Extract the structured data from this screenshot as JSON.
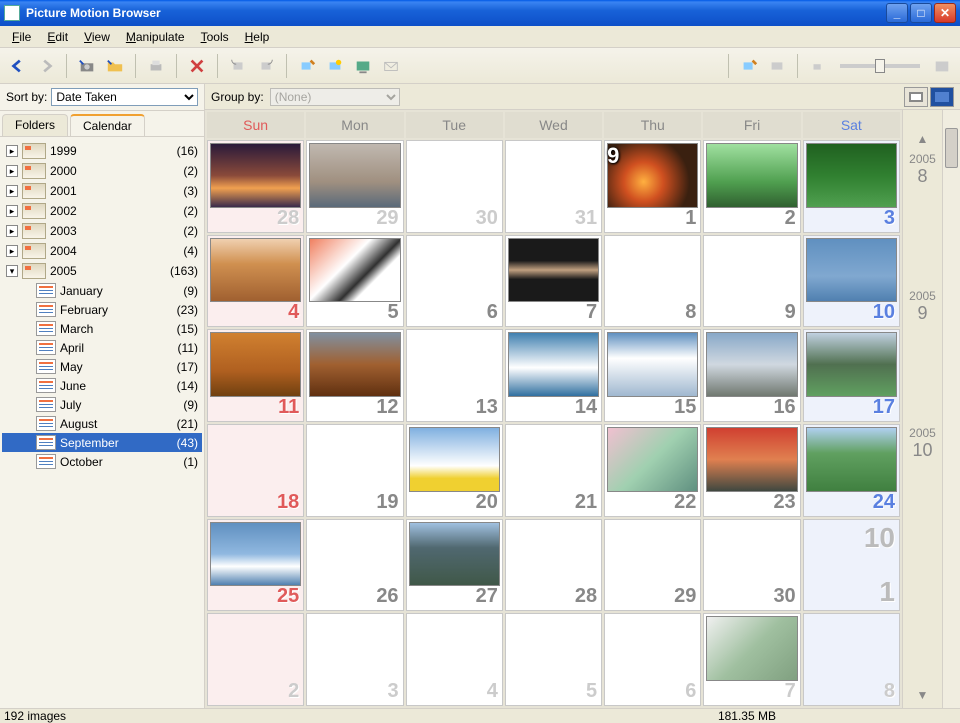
{
  "window": {
    "title": "Picture Motion Browser"
  },
  "menu": {
    "file": "File",
    "edit": "Edit",
    "view": "View",
    "manipulate": "Manipulate",
    "tools": "Tools",
    "help": "Help"
  },
  "sidebar": {
    "sort_label": "Sort by:",
    "sort_value": "Date Taken",
    "tabs": {
      "folders": "Folders",
      "calendar": "Calendar"
    },
    "years": [
      {
        "label": "1999",
        "count": "(16)"
      },
      {
        "label": "2000",
        "count": "(2)"
      },
      {
        "label": "2001",
        "count": "(3)"
      },
      {
        "label": "2002",
        "count": "(2)"
      },
      {
        "label": "2003",
        "count": "(2)"
      },
      {
        "label": "2004",
        "count": "(4)"
      },
      {
        "label": "2005",
        "count": "(163)"
      }
    ],
    "months": [
      {
        "label": "January",
        "count": "(9)"
      },
      {
        "label": "February",
        "count": "(23)"
      },
      {
        "label": "March",
        "count": "(15)"
      },
      {
        "label": "April",
        "count": "(11)"
      },
      {
        "label": "May",
        "count": "(17)"
      },
      {
        "label": "June",
        "count": "(14)"
      },
      {
        "label": "July",
        "count": "(9)"
      },
      {
        "label": "August",
        "count": "(21)"
      },
      {
        "label": "September",
        "count": "(43)"
      },
      {
        "label": "October",
        "count": "(1)"
      }
    ],
    "selected_month_index": 8
  },
  "content": {
    "group_label": "Group by:",
    "group_value": "(None)",
    "day_headers": [
      "Sun",
      "Mon",
      "Tue",
      "Wed",
      "Thu",
      "Fri",
      "Sat"
    ],
    "side_labels": [
      {
        "year": "2005",
        "month": "8"
      },
      {
        "year": "2005",
        "month": "9"
      },
      {
        "year": "2005",
        "month": "10"
      }
    ],
    "weeks": [
      [
        {
          "day": "28",
          "cls": "sun other",
          "thumb": "linear-gradient(to bottom,#2a1a3a 0%,#8a4a3a 50%,#f0a050 70%,#3a2a4a 100%)"
        },
        {
          "day": "29",
          "cls": "other",
          "thumb": "linear-gradient(to bottom,#c0b8b0 0%,#a09080 60%,#5a6a7a 100%)"
        },
        {
          "day": "30",
          "cls": "other"
        },
        {
          "day": "31",
          "cls": "other"
        },
        {
          "day": "1",
          "cls": "",
          "badge": "9",
          "thumb": "radial-gradient(circle at 40% 60%,#ffb040,#d05020 30%,#3a2010 70%)"
        },
        {
          "day": "2",
          "cls": "",
          "thumb": "linear-gradient(to bottom,#a0e0a0 0%,#50a050 60%,#306030 100%)"
        },
        {
          "day": "3",
          "cls": "sat",
          "thumb": "linear-gradient(to bottom,#206020 0%,#308030 50%,#50a050 100%)"
        }
      ],
      [
        {
          "day": "4",
          "cls": "sun",
          "thumb": "linear-gradient(to bottom,#f0d0b0 0%,#d09050 40%,#a06030 100%)"
        },
        {
          "day": "5",
          "cls": "",
          "thumb": "linear-gradient(135deg,#f08060 0%,#ffffff 40%,#303030 60%,#ffffff 70%)"
        },
        {
          "day": "6",
          "cls": ""
        },
        {
          "day": "7",
          "cls": "",
          "thumb": "linear-gradient(to bottom,#1a1a1a 0%,#1a1a1a 35%,#c0a080 50%,#1a1a1a 65%)"
        },
        {
          "day": "8",
          "cls": ""
        },
        {
          "day": "9",
          "cls": ""
        },
        {
          "day": "10",
          "cls": "sat",
          "thumb": "linear-gradient(to bottom,#6090c0 0%,#80a8d0 60%,#5080b0 100%)"
        }
      ],
      [
        {
          "day": "11",
          "cls": "sun",
          "thumb": "linear-gradient(to bottom,#d08030 0%,#b06020 60%,#704010 100%)"
        },
        {
          "day": "12",
          "cls": "",
          "thumb": "linear-gradient(to bottom,#8090a0 0%,#a06030 50%,#603010 100%)"
        },
        {
          "day": "13",
          "cls": ""
        },
        {
          "day": "14",
          "cls": "",
          "thumb": "linear-gradient(to bottom,#4080b0 0%,#ffffff 55%,#3070a0 100%)"
        },
        {
          "day": "15",
          "cls": "",
          "thumb": "linear-gradient(to bottom,#6090c0 0%,#ffffff 40%,#a0b8d0 100%)"
        },
        {
          "day": "16",
          "cls": "",
          "thumb": "linear-gradient(to bottom,#88a8c8 0%,#d0d8e0 50%,#707870 100%)"
        },
        {
          "day": "17",
          "cls": "sat",
          "thumb": "linear-gradient(to bottom,#c0d0e0 0%,#507050 50%,#60a060 100%)"
        }
      ],
      [
        {
          "day": "18",
          "cls": "sun"
        },
        {
          "day": "19",
          "cls": ""
        },
        {
          "day": "20",
          "cls": "",
          "thumb": "linear-gradient(to bottom,#80b0e0 0%,#ffffff 60%,#f0d030 80%)"
        },
        {
          "day": "21",
          "cls": ""
        },
        {
          "day": "22",
          "cls": "",
          "thumb": "linear-gradient(135deg,#f0c0d0 0%,#a0d0b0 50%,#609080 100%)"
        },
        {
          "day": "23",
          "cls": "",
          "thumb": "linear-gradient(to bottom,#d04030 0%,#e08050 50%,#404840 100%)"
        },
        {
          "day": "24",
          "cls": "sat",
          "thumb": "linear-gradient(to bottom,#b0d0f0 0%,#60a060 40%,#408040 100%)"
        }
      ],
      [
        {
          "day": "25",
          "cls": "sun",
          "thumb": "linear-gradient(to bottom,#6090c0 0%,#90b8e0 50%,#ffffff 70%,#5080b0 100%)"
        },
        {
          "day": "26",
          "cls": ""
        },
        {
          "day": "27",
          "cls": "",
          "thumb": "linear-gradient(to bottom,#a0c0e0 0%,#506870 40%,#405848 100%)"
        },
        {
          "day": "28",
          "cls": ""
        },
        {
          "day": "29",
          "cls": ""
        },
        {
          "day": "30",
          "cls": ""
        },
        {
          "day": "1",
          "cls": "sat nextmonth",
          "bignum": "10"
        }
      ],
      [
        {
          "day": "2",
          "cls": "sun other"
        },
        {
          "day": "3",
          "cls": "other"
        },
        {
          "day": "4",
          "cls": "other"
        },
        {
          "day": "5",
          "cls": "other"
        },
        {
          "day": "6",
          "cls": "other"
        },
        {
          "day": "7",
          "cls": "other",
          "thumb": "linear-gradient(135deg,#f0f0f0 0%,#a0c0a0 50%,#80a080 100%)"
        },
        {
          "day": "8",
          "cls": "sat other"
        }
      ]
    ]
  },
  "status": {
    "left": "192 images",
    "right": "181.35 MB"
  }
}
